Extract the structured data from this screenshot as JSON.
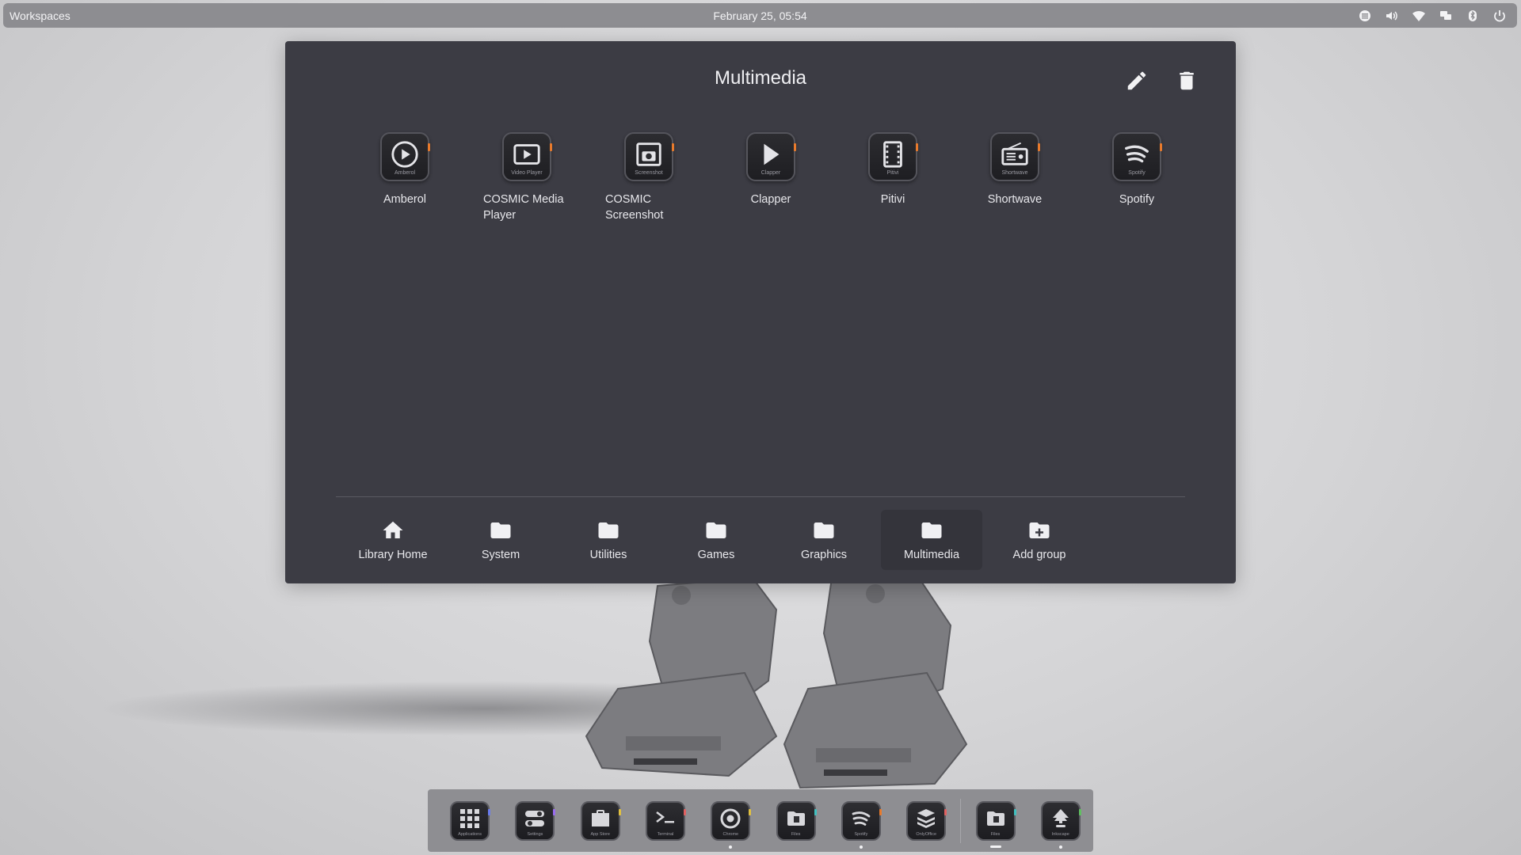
{
  "top_panel": {
    "workspaces_label": "Workspaces",
    "clock": "February 25, 05:54",
    "tray_icons": [
      "notifications-icon",
      "volume-icon",
      "wifi-icon",
      "display-icon",
      "bluetooth-icon",
      "power-icon"
    ]
  },
  "library": {
    "title": "Multimedia",
    "apps": [
      {
        "label": "Amberol",
        "icon_caption": "Amberol",
        "icon": "music-play-icon"
      },
      {
        "label": "COSMIC Media Player",
        "icon_caption": "Video Player",
        "icon": "video-player-icon"
      },
      {
        "label": "COSMIC Screenshot",
        "icon_caption": "Screenshot",
        "icon": "screenshot-icon"
      },
      {
        "label": "Clapper",
        "icon_caption": "Clapper",
        "icon": "play-icon"
      },
      {
        "label": "Pitivi",
        "icon_caption": "Pitivi",
        "icon": "film-icon"
      },
      {
        "label": "Shortwave",
        "icon_caption": "Shortwave",
        "icon": "radio-icon"
      },
      {
        "label": "Spotify",
        "icon_caption": "Spotify",
        "icon": "spotify-icon"
      }
    ],
    "groups": [
      {
        "label": "Library Home",
        "icon": "home-icon"
      },
      {
        "label": "System",
        "icon": "folder-icon"
      },
      {
        "label": "Utilities",
        "icon": "folder-icon"
      },
      {
        "label": "Games",
        "icon": "folder-icon"
      },
      {
        "label": "Graphics",
        "icon": "folder-icon"
      },
      {
        "label": "Multimedia",
        "icon": "folder-icon",
        "active": true
      },
      {
        "label": "Add group",
        "icon": "folder-add-icon"
      }
    ]
  },
  "dock": {
    "items": [
      {
        "caption": "Applications",
        "icon": "grid-icon",
        "accent": "#6a7cf0",
        "indicator": "none"
      },
      {
        "caption": "Settings",
        "icon": "toggles-icon",
        "accent": "#9a6cf0",
        "indicator": "none"
      },
      {
        "caption": "App Store",
        "icon": "store-icon",
        "accent": "#e0c040",
        "indicator": "none"
      },
      {
        "caption": "Terminal",
        "icon": "terminal-icon",
        "accent": "#e06060",
        "indicator": "none"
      },
      {
        "caption": "Chrome",
        "icon": "chrome-icon",
        "accent": "#e0c040",
        "indicator": "dot"
      },
      {
        "caption": "Files",
        "icon": "files-icon",
        "accent": "#40c0c0",
        "indicator": "none"
      },
      {
        "caption": "Spotify",
        "icon": "spotify-icon",
        "accent": "#e87a2c",
        "indicator": "dot"
      },
      {
        "caption": "OnlyOffice",
        "icon": "layers-icon",
        "accent": "#e06060",
        "indicator": "none"
      },
      {
        "caption": "Files",
        "icon": "files-icon",
        "accent": "#40c0c0",
        "indicator": "dash"
      },
      {
        "caption": "Inkscape",
        "icon": "inkscape-icon",
        "accent": "#60c060",
        "indicator": "dot"
      }
    ]
  }
}
